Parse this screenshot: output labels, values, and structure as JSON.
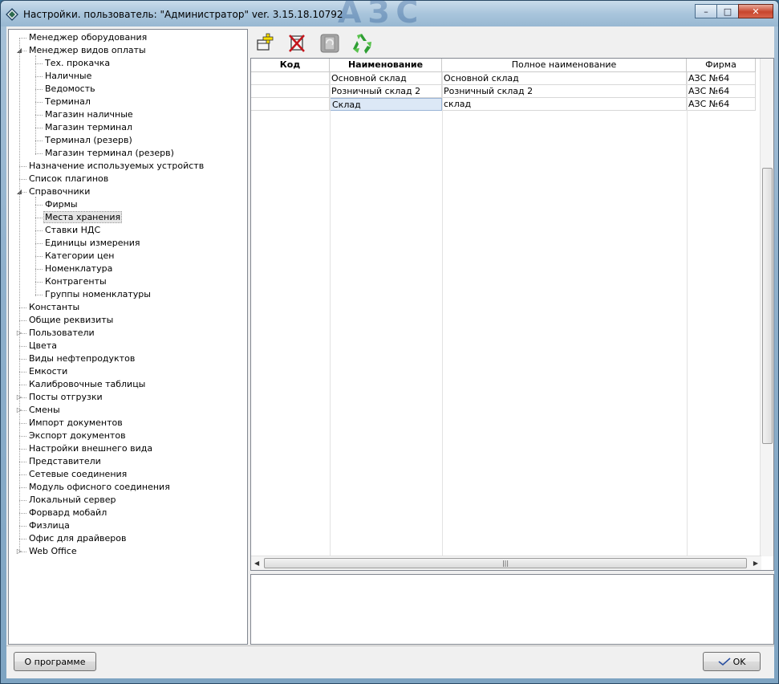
{
  "window": {
    "title": "Настройки. пользователь: \"Администратор\" ver. 3.15.18.10792",
    "watermark": "АЗС",
    "minimize": "–",
    "maximize": "□",
    "close": "✕"
  },
  "tree": [
    {
      "label": "Менеджер оборудования",
      "level": 0,
      "expander": "none"
    },
    {
      "label": "Менеджер видов оплаты",
      "level": 0,
      "expander": "expanded"
    },
    {
      "label": "Тех. прокачка",
      "level": 1
    },
    {
      "label": "Наличные",
      "level": 1
    },
    {
      "label": "Ведомость",
      "level": 1
    },
    {
      "label": "Терминал",
      "level": 1
    },
    {
      "label": "Магазин наличные",
      "level": 1
    },
    {
      "label": "Магазин терминал",
      "level": 1
    },
    {
      "label": "Терминал (резерв)",
      "level": 1
    },
    {
      "label": "Магазин терминал (резерв)",
      "level": 1
    },
    {
      "label": "Назначение используемых устройств",
      "level": 0,
      "expander": "none"
    },
    {
      "label": "Список плагинов",
      "level": 0,
      "expander": "none"
    },
    {
      "label": "Справочники",
      "level": 0,
      "expander": "expanded"
    },
    {
      "label": "Фирмы",
      "level": 1
    },
    {
      "label": "Места хранения",
      "level": 1,
      "selected": true
    },
    {
      "label": "Ставки НДС",
      "level": 1
    },
    {
      "label": "Единицы измерения",
      "level": 1
    },
    {
      "label": "Категории цен",
      "level": 1
    },
    {
      "label": "Номенклатура",
      "level": 1
    },
    {
      "label": "Контрагенты",
      "level": 1
    },
    {
      "label": "Группы номенклатуры",
      "level": 1
    },
    {
      "label": "Константы",
      "level": 0,
      "expander": "none"
    },
    {
      "label": "Общие реквизиты",
      "level": 0,
      "expander": "none"
    },
    {
      "label": "Пользователи",
      "level": 0,
      "expander": "collapsed"
    },
    {
      "label": "Цвета",
      "level": 0,
      "expander": "none"
    },
    {
      "label": "Виды нефтепродуктов",
      "level": 0,
      "expander": "none"
    },
    {
      "label": "Емкости",
      "level": 0,
      "expander": "none"
    },
    {
      "label": "Калибровочные таблицы",
      "level": 0,
      "expander": "none"
    },
    {
      "label": "Посты отгрузки",
      "level": 0,
      "expander": "collapsed"
    },
    {
      "label": "Смены",
      "level": 0,
      "expander": "collapsed"
    },
    {
      "label": "Импорт документов",
      "level": 0,
      "expander": "none"
    },
    {
      "label": "Экспорт документов",
      "level": 0,
      "expander": "none"
    },
    {
      "label": "Настройки внешнего вида",
      "level": 0,
      "expander": "none"
    },
    {
      "label": "Представители",
      "level": 0,
      "expander": "none"
    },
    {
      "label": "Сетевые соединения",
      "level": 0,
      "expander": "none"
    },
    {
      "label": "Модуль офисного соединения",
      "level": 0,
      "expander": "none"
    },
    {
      "label": "Локальный сервер",
      "level": 0,
      "expander": "none"
    },
    {
      "label": "Форвард мобайл",
      "level": 0,
      "expander": "none"
    },
    {
      "label": "Физлица",
      "level": 0,
      "expander": "none"
    },
    {
      "label": "Офис для драйверов",
      "level": 0,
      "expander": "none"
    },
    {
      "label": "Web Office",
      "level": 0,
      "expander": "collapsed"
    }
  ],
  "toolbar": {
    "add_icon": "add-record-icon",
    "delete_icon": "delete-record-icon",
    "edit_icon": "edit-record-icon",
    "refresh_icon": "refresh-icon"
  },
  "grid": {
    "columns": [
      {
        "label": "Код",
        "bold": true
      },
      {
        "label": "Наименование",
        "bold": true
      },
      {
        "label": "Полное наименование",
        "bold": false
      },
      {
        "label": "Фирма",
        "bold": false
      }
    ],
    "rows": [
      [
        "",
        "Основной склад",
        "Основной склад",
        "АЗС №64"
      ],
      [
        "",
        "Розничный склад 2",
        "Розничный склад 2",
        "АЗС №64"
      ],
      [
        "",
        "Склад",
        "склад",
        "АЗС №64"
      ]
    ],
    "focused_row": 2,
    "focused_col": 1
  },
  "buttons": {
    "about": "О программе",
    "ok": "OK"
  }
}
